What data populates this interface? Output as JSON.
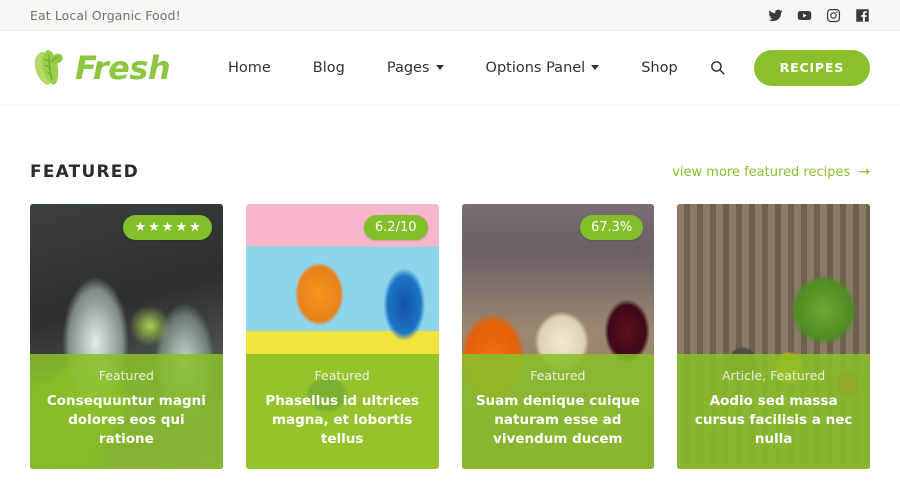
{
  "topbar": {
    "tagline": "Eat Local Organic Food!",
    "social": [
      {
        "name": "twitter-icon",
        "label": "Twitter"
      },
      {
        "name": "youtube-icon",
        "label": "YouTube"
      },
      {
        "name": "instagram-icon",
        "label": "Instagram"
      },
      {
        "name": "facebook-icon",
        "label": "Facebook"
      }
    ]
  },
  "header": {
    "brand_name": "Fresh",
    "logo_icon": "lettuce-leaf-icon",
    "nav": [
      {
        "label": "Home",
        "has_dropdown": false
      },
      {
        "label": "Blog",
        "has_dropdown": false
      },
      {
        "label": "Pages",
        "has_dropdown": true
      },
      {
        "label": "Options Panel",
        "has_dropdown": true
      },
      {
        "label": "Shop",
        "has_dropdown": false
      }
    ],
    "search_icon": "search-icon",
    "cta_label": "RECIPES"
  },
  "featured": {
    "section_title": "FEATURED",
    "more_link": "view more featured recipes",
    "more_arrow": "→",
    "cards": [
      {
        "badge_type": "stars",
        "badge_value": "★★★★★",
        "stars": 5,
        "category": "Featured",
        "title": "Consequuntur magni dolores eos qui ratione",
        "photo": "photo-drinks"
      },
      {
        "badge_type": "score",
        "badge_value": "6.2/10",
        "category": "Featured",
        "title": "Phasellus id ultrices magna, et lobortis tellus",
        "photo": "photo-cocktails"
      },
      {
        "badge_type": "percent",
        "badge_value": "67.3%",
        "category": "Featured",
        "title": "Suam denique cuique naturam esse ad vivendum ducem",
        "photo": "photo-market"
      },
      {
        "badge_type": "none",
        "badge_value": "",
        "category": "Article, Featured",
        "title": "Aodio sed massa cursus facilisis a nec nulla",
        "photo": "photo-basket"
      }
    ]
  },
  "colors": {
    "brand_green": "#8ec63f",
    "button_green": "#8cbf2c",
    "badge_green": "#83bf2a",
    "overlay_green": "#89be29",
    "topbar_bg": "#f6f8f1",
    "text_dark": "#333333"
  }
}
